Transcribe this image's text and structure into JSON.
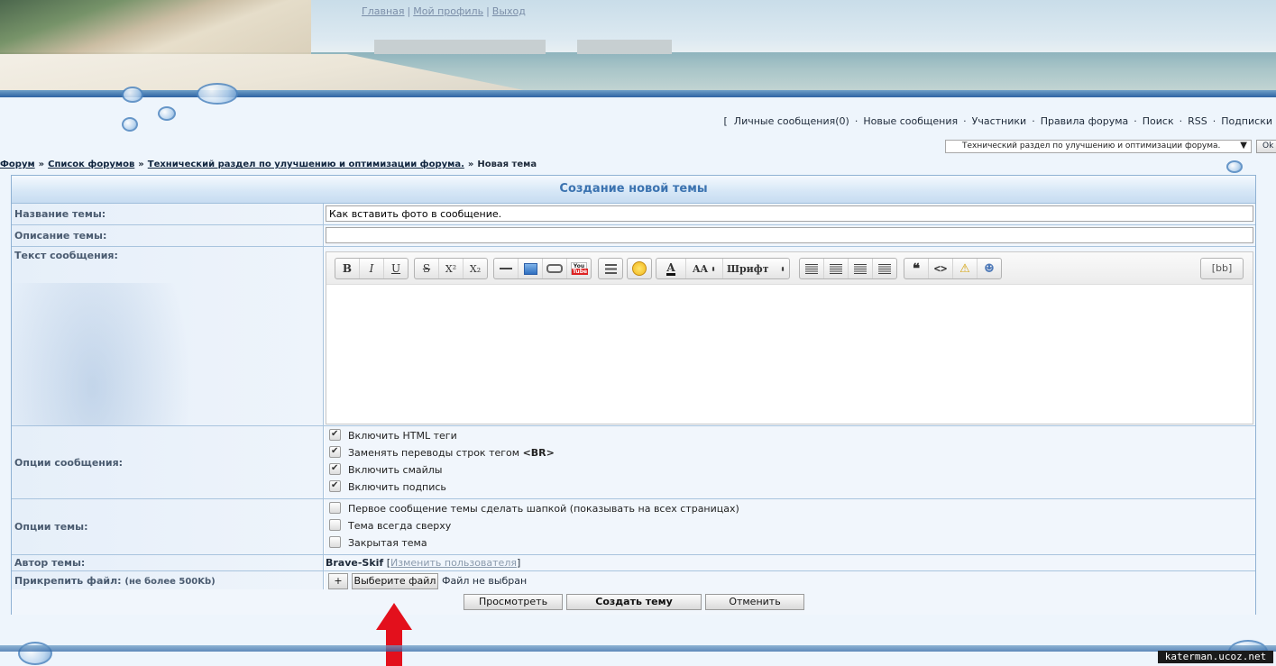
{
  "header": {
    "links": [
      "Главная",
      "Мой профиль",
      "Выход"
    ]
  },
  "usermenu": {
    "bracket": "[",
    "items": [
      "Личные сообщения(0)",
      "Новые сообщения",
      "Участники",
      "Правила форума",
      "Поиск",
      "RSS",
      "Подписки"
    ]
  },
  "jump": {
    "selected": "Технический раздел по улучшению и оптимизации форума.",
    "ok_label": "Ok"
  },
  "breadcrumb": {
    "items": [
      "Форум",
      "Список форумов",
      "Технический раздел по улучшению и оптимизации форума."
    ],
    "current": "Новая тема",
    "separator": "»"
  },
  "form": {
    "title": "Создание новой темы",
    "topic_name_label": "Название темы:",
    "topic_name_value": "Как вставить фото в сообщение.",
    "topic_desc_label": "Описание темы:",
    "topic_desc_value": "",
    "message_label": "Текст сообщения:",
    "editor": {
      "toolbar": [
        "B",
        "I",
        "U",
        "S",
        "X²",
        "X₂",
        "—",
        "image",
        "link",
        "YouTube",
        "list",
        "smiley",
        "A",
        "AA",
        "Шрифт",
        "align-left",
        "align-center",
        "align-right",
        "justify",
        "quote",
        "<>",
        "spoiler",
        "hide"
      ],
      "font_select": "Шрифт",
      "bb_label": "[bb]"
    },
    "msg_options_label": "Опции сообщения:",
    "msg_options": [
      {
        "label": "Включить HTML теги",
        "checked": true
      },
      {
        "label": "Заменять переводы строк тегом",
        "suffix": "<BR>",
        "checked": true
      },
      {
        "label": "Включить смайлы",
        "checked": true
      },
      {
        "label": "Включить подпись",
        "checked": true
      }
    ],
    "topic_options_label": "Опции темы:",
    "topic_options": [
      {
        "label": "Первое сообщение темы сделать шапкой (показывать на всех страницах)",
        "checked": false
      },
      {
        "label": "Тема всегда сверху",
        "checked": false
      },
      {
        "label": "Закрытая тема",
        "checked": false
      }
    ],
    "author_label": "Автор темы:",
    "author_name": "Brave-Skif",
    "change_user": "Изменить пользователя",
    "attach_label": "Прикрепить файл:",
    "attach_note": "(не более 500Kb)",
    "attach_plus": "+",
    "choose_file": "Выберите файл",
    "no_file": "Файл не выбран",
    "preview_btn": "Просмотреть",
    "create_btn": "Создать тему",
    "cancel_btn": "Отменить"
  },
  "watermark": "katerman.ucoz.net",
  "colors": {
    "accent": "#3b73b0",
    "arrow": "#e3101c"
  }
}
